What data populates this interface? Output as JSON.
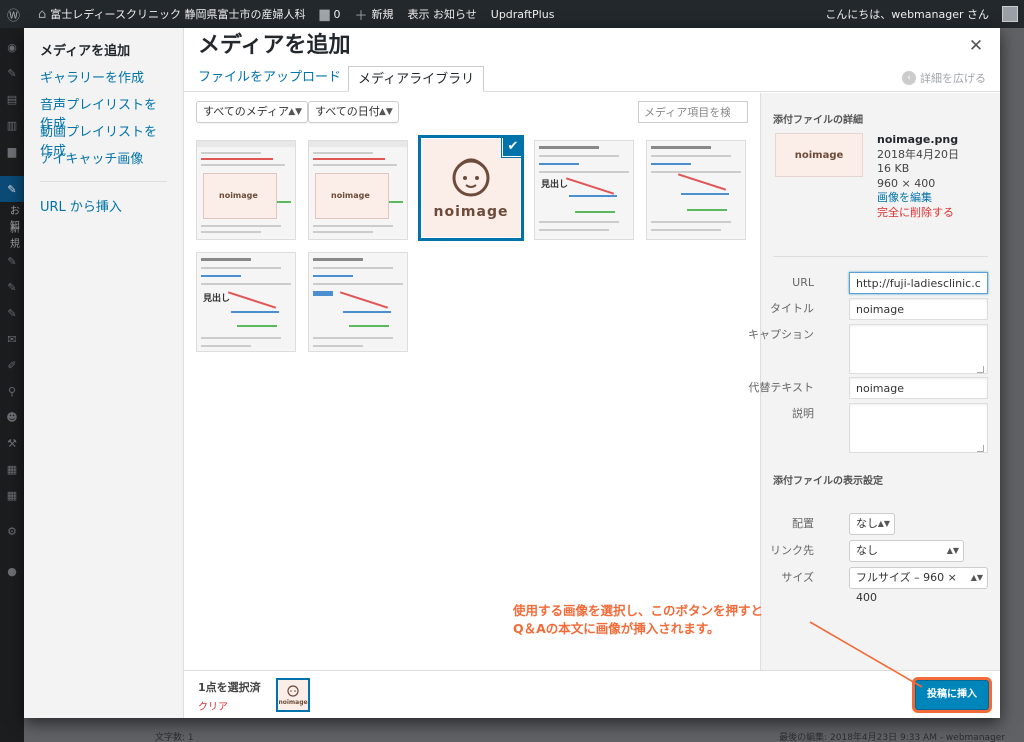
{
  "admin_bar": {
    "site_name": "富士レディースクリニック 静岡県富士市の産婦人科",
    "comments_count": "0",
    "new_label": "新規",
    "notice_label": "表示 お知らせ",
    "plugin_label": "UpdraftPlus",
    "greeting": "こんにちは、webmanager さん"
  },
  "left_menu_partial": [
    "お知",
    "新規"
  ],
  "modal": {
    "title": "メディアを追加",
    "close_glyph": "✕",
    "side_menu": [
      "メディアを追加",
      "ギャラリーを作成",
      "音声プレイリストを作成",
      "動画プレイリストを作成",
      "アイキャッチ画像"
    ],
    "insert_from_url": "URL から挿入",
    "tabs": [
      "ファイルをアップロード",
      "メディアライブラリ"
    ],
    "expand_details": "詳細を広げる",
    "filters": {
      "media_type": "すべてのメディア",
      "date": "すべての日付",
      "search_placeholder": "メディア項目を検索..."
    },
    "selected_thumb_text": "noimage",
    "details": {
      "heading": "添付ファイルの詳細",
      "filename": "noimage.png",
      "date": "2018年4月20日",
      "size": "16 KB",
      "dimensions": "960 × 400",
      "edit_link": "画像を編集",
      "delete_link": "完全に削除する",
      "fields": {
        "url_label": "URL",
        "url_value": "http://fuji-ladiesclinic.com/wp",
        "title_label": "タイトル",
        "title_value": "noimage",
        "caption_label": "キャプション",
        "caption_value": "",
        "alt_label": "代替テキスト",
        "alt_value": "noimage",
        "description_label": "説明",
        "description_value": ""
      },
      "display_settings": {
        "heading": "添付ファイルの表示設定",
        "align_label": "配置",
        "align_value": "なし",
        "link_label": "リンク先",
        "link_value": "なし",
        "size_label": "サイズ",
        "size_value": "フルサイズ – 960 × 400"
      }
    },
    "selection": {
      "count_text": "1点を選択済",
      "clear_text": "クリア",
      "thumb_text": "noimage"
    },
    "insert_button": "投稿に挿入"
  },
  "annotation": {
    "line1": "使用する画像を選択し、このボタンを押すと",
    "line2": "Q＆Aの本文に画像が挿入されます。"
  },
  "background_footer": {
    "word_count": "文字数: 1",
    "last_edit": "最後の編集: 2018年4月23日 9:33 AM - webmanager"
  },
  "colors": {
    "link": "#0073aa",
    "danger": "#dc3232",
    "annotation": "#f26b38",
    "primary_button": "#0085ba"
  }
}
